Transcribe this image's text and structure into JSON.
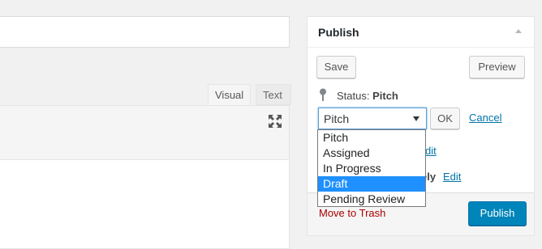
{
  "editor": {
    "tabs": [
      {
        "label": "Visual",
        "active": true
      },
      {
        "label": "Text",
        "active": false
      }
    ]
  },
  "publish": {
    "title": "Publish",
    "save_label": "Save",
    "preview_label": "Preview",
    "status_prefix": "Status: ",
    "status_value": "Pitch",
    "select_value": "Pitch",
    "ok_label": "OK",
    "cancel_label": "Cancel",
    "hidden_edit_1": "dit",
    "visibility_partial": "ely",
    "hidden_edit_2": "Edit",
    "trash_label": "Move to Trash",
    "publish_label": "Publish",
    "accent_color": "#0085ba",
    "trash_color": "#a00"
  },
  "dropdown": {
    "options": [
      "Pitch",
      "Assigned",
      "In Progress",
      "Draft",
      "Pending Review"
    ],
    "selected": "Draft"
  }
}
